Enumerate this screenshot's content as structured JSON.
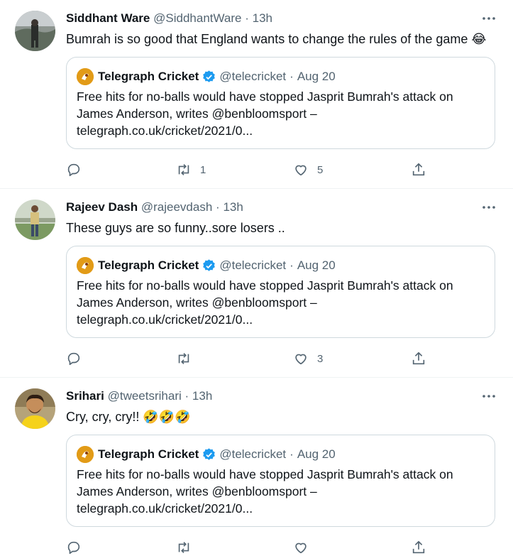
{
  "tweets": [
    {
      "name": "Siddhant Ware",
      "handle": "@SiddhantWare",
      "sep": "·",
      "time": "13h",
      "text": "Bumrah is so good that England wants to change the rules of the game 😂",
      "quote": {
        "name": "Telegraph Cricket",
        "handle": "@telecricket",
        "sep": "·",
        "time": "Aug 20",
        "line1": "Free hits for no-balls would have stopped Jasprit Bumrah's attack on",
        "line2": "James Anderson, writes @benbloomsport –",
        "line3": "telegraph.co.uk/cricket/2021/0..."
      },
      "replies": "",
      "retweets": "1",
      "likes": "5"
    },
    {
      "name": "Rajeev Dash",
      "handle": "@rajeevdash",
      "sep": "·",
      "time": "13h",
      "text": "These guys are so funny..sore losers ..",
      "quote": {
        "name": "Telegraph Cricket",
        "handle": "@telecricket",
        "sep": "·",
        "time": "Aug 20",
        "line1": "Free hits for no-balls would have stopped Jasprit Bumrah's attack on",
        "line2": "James Anderson, writes @benbloomsport –",
        "line3": "telegraph.co.uk/cricket/2021/0..."
      },
      "replies": "",
      "retweets": "",
      "likes": "3"
    },
    {
      "name": "Srihari",
      "handle": "@tweetsrihari",
      "sep": "·",
      "time": "13h",
      "text": "Cry, cry, cry!! 🤣🤣🤣",
      "quote": {
        "name": "Telegraph Cricket",
        "handle": "@telecricket",
        "sep": "·",
        "time": "Aug 20",
        "line1": "Free hits for no-balls would have stopped Jasprit Bumrah's attack on",
        "line2": "James Anderson, writes @benbloomsport –",
        "line3": "telegraph.co.uk/cricket/2021/0..."
      },
      "replies": "",
      "retweets": "",
      "likes": ""
    }
  ],
  "icons": {
    "reply": "reply-icon",
    "retweet": "retweet-icon",
    "like": "heart-icon",
    "share": "share-icon",
    "more": "more-icon",
    "verified": "verified-badge-icon"
  },
  "colors": {
    "text": "#0f1419",
    "secondary": "#536471",
    "border": "#cfd9de",
    "divider": "#eff3f4",
    "verified": "#1d9bf0"
  }
}
